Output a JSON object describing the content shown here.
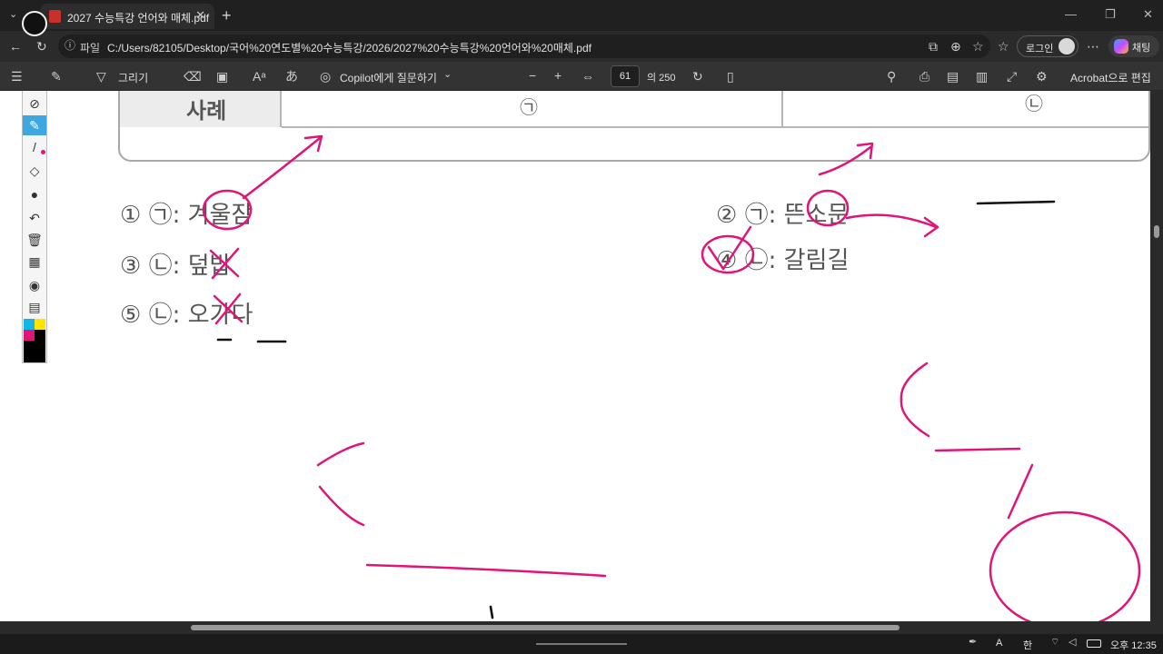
{
  "browser": {
    "tab_title": "2027 수능특강 언어와 매체.pdf",
    "tab_close": "✕",
    "new_tab": "+",
    "address_label": "파일",
    "url": "C:/Users/82105/Desktop/국어%20연도별%20수능특강/2026/2027%20수능특강%20언어와%20매체.pdf",
    "login_label": "로그인",
    "chat_label": "채팅"
  },
  "pdf_toolbar": {
    "draw_label": "그리기",
    "copilot_label": "Copilot에게 질문하기",
    "page_current": "61",
    "page_total": "의 250",
    "acrobat_label": "Acrobat으로 편집",
    "minus": "−",
    "plus": "+"
  },
  "document": {
    "table_header": "사례",
    "col_a_marker": "㉠",
    "col_b_marker": "㉡",
    "options": [
      {
        "num": "①",
        "marker": "㉠",
        "word": "겨울잠"
      },
      {
        "num": "③",
        "marker": "㉡",
        "word": "덮밥"
      },
      {
        "num": "⑤",
        "marker": "㉡",
        "word": "오가다"
      },
      {
        "num": "②",
        "marker": "㉠",
        "word": "뜬소문"
      },
      {
        "num": "④",
        "marker": "㉡",
        "word": "갈림길"
      }
    ]
  },
  "taskbar": {
    "ime_label": "A",
    "lang_label": "한",
    "clock": "오후 12:35"
  },
  "annotation_color": "#e0157a"
}
